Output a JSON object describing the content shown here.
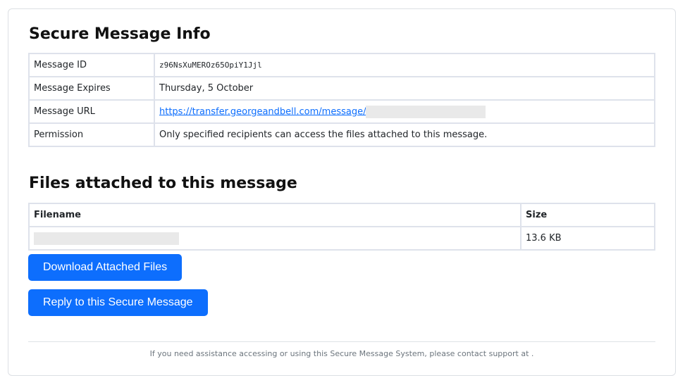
{
  "info": {
    "title": "Secure Message Info",
    "rows": [
      {
        "label": "Message ID",
        "value": "z96NsXuMEROz65OpiY1Jjl"
      },
      {
        "label": "Message Expires",
        "value": "Thursday, 5 October"
      },
      {
        "label": "Message URL",
        "value": "https://transfer.georgeandbell.com/message/"
      },
      {
        "label": "Permission",
        "value": "Only specified recipients can access the files attached to this message."
      }
    ]
  },
  "files": {
    "title": "Files attached to this message",
    "headers": {
      "filename": "Filename",
      "size": "Size"
    },
    "rows": [
      {
        "filename": "",
        "size": "13.6 KB"
      }
    ]
  },
  "buttons": {
    "download": "Download Attached Files",
    "reply": "Reply to this Secure Message"
  },
  "footer": {
    "text": "If you need assistance accessing or using this Secure Message System, please contact support at ."
  },
  "colors": {
    "accent": "#0d6efd",
    "border": "#dee2eb",
    "redaction": "#e9e9e9"
  }
}
